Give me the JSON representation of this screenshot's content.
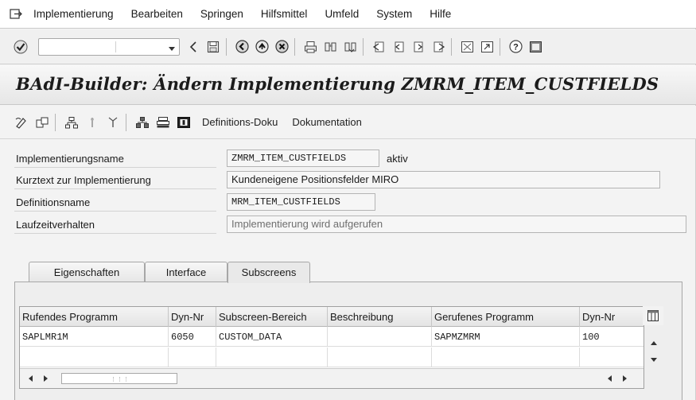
{
  "menubar": {
    "items": [
      {
        "label": "Implementierung"
      },
      {
        "label": "Bearbeiten"
      },
      {
        "label": "Springen"
      },
      {
        "label": "Hilfsmittel"
      },
      {
        "label": "Umfeld"
      },
      {
        "label": "System"
      },
      {
        "label": "Hilfe"
      }
    ]
  },
  "toolbar": {
    "command_field_value": "",
    "icons": [
      "enter-check-icon",
      "back-arrow-icon",
      "save-icon",
      "back-icon",
      "exit-icon",
      "cancel-icon",
      "print-icon",
      "find-icon",
      "find-next-icon",
      "first-page-icon",
      "previous-page-icon",
      "next-page-icon",
      "last-page-icon",
      "new-session-icon",
      "shortcut-icon",
      "help-icon",
      "layout-menu-icon"
    ]
  },
  "title": "BAdI-Builder: Ändern Implementierung ZMRM_ITEM_CUSTFIELDS",
  "app_toolbar": {
    "icons": [
      "display-change-icon",
      "other-object-icon",
      "hierarchy-icon",
      "activate-icon",
      "deactivate-icon",
      "object-list-icon",
      "where-used-icon",
      "info-icon"
    ],
    "definition_doc": "Definitions-Doku",
    "documentation": "Dokumentation"
  },
  "form": {
    "impl_name_label": "Implementierungsname",
    "impl_name_value": "ZMRM_ITEM_CUSTFIELDS",
    "impl_status": "aktiv",
    "short_text_label": "Kurztext zur Implementierung",
    "short_text_value": "Kundeneigene Positionsfelder MIRO",
    "definition_label": "Definitionsname",
    "definition_value": "MRM_ITEM_CUSTFIELDS",
    "runtime_label": "Laufzeitverhalten",
    "runtime_value": "Implementierung wird aufgerufen"
  },
  "tabs": [
    {
      "label": "Eigenschaften",
      "active": false
    },
    {
      "label": "Interface",
      "active": false
    },
    {
      "label": "Subscreens",
      "active": true
    }
  ],
  "table": {
    "columns": [
      "Rufendes Programm",
      "Dyn-Nr",
      "Subscreen-Bereich",
      "Beschreibung",
      "Gerufenes Programm",
      "Dyn-Nr"
    ],
    "rows": [
      [
        "SAPLMR1M",
        "6050",
        "CUSTOM_DATA",
        "",
        "SAPMZMRM",
        "100"
      ],
      [
        "",
        "",
        "",
        "",
        "",
        ""
      ]
    ]
  }
}
